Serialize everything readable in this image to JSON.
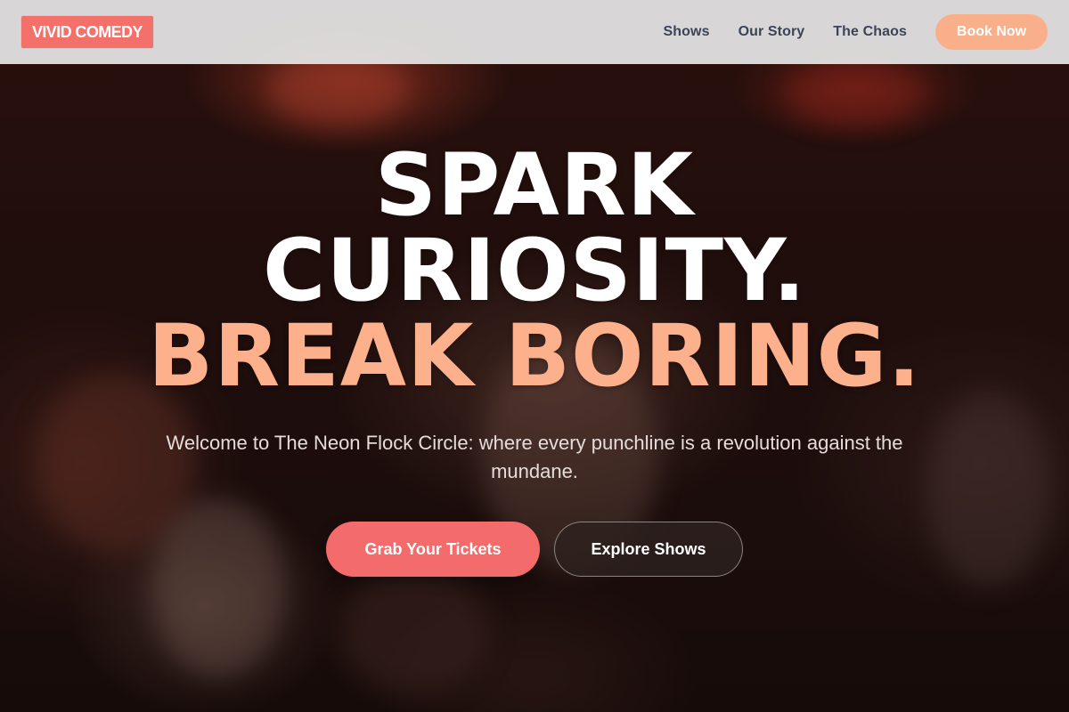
{
  "header": {
    "logo": "VIVID COMEDY",
    "nav": [
      {
        "label": "Shows"
      },
      {
        "label": "Our Story"
      },
      {
        "label": "The Chaos"
      }
    ],
    "book_button": "Book Now"
  },
  "hero": {
    "headline": {
      "line1": "SPARK",
      "line2": "CURIOSITY.",
      "line3": "BREAK BORING."
    },
    "subtitle": "Welcome to The Neon Flock Circle: where every punchline is a revolution against the mundane.",
    "primary_cta": "Grab Your Tickets",
    "secondary_cta": "Explore Shows"
  },
  "colors": {
    "logo_bg": "#f4706b",
    "accent_peach": "#fcb08c",
    "book_button_bg": "#f9b08a",
    "primary_cta_bg": "#f46b6b",
    "nav_text": "#3b4457"
  }
}
